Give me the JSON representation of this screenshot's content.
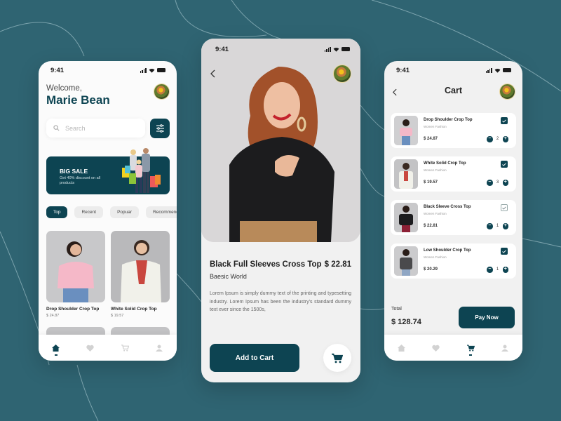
{
  "theme": {
    "primary": "#0d4452",
    "background": "#2f6472",
    "surface": "#f1f1f1"
  },
  "status_bar": {
    "time": "9:41",
    "icons": [
      "signal-icon",
      "wifi-icon",
      "battery-icon"
    ]
  },
  "home": {
    "welcome": "Welcome,",
    "username": "Marie Bean",
    "search": {
      "placeholder": "Search",
      "value": ""
    },
    "filter_icon": "sliders-icon",
    "banner": {
      "title": "BIG SALE",
      "subtitle": "Get 40% discount on all products"
    },
    "tabs": [
      {
        "label": "Top",
        "active": true
      },
      {
        "label": "Recent",
        "active": false
      },
      {
        "label": "Popuar",
        "active": false
      },
      {
        "label": "Recommended",
        "active": false
      }
    ],
    "products": [
      {
        "name": "Drop Shoulder Crop Top",
        "price": "$ 24.87"
      },
      {
        "name": "White Solid Crop Top",
        "price": "$ 19.57"
      }
    ],
    "nav": [
      {
        "icon": "home-icon",
        "active": true
      },
      {
        "icon": "heart-icon",
        "active": false
      },
      {
        "icon": "cart-icon",
        "active": false
      },
      {
        "icon": "user-icon",
        "active": false
      }
    ]
  },
  "detail": {
    "title": "Black Full Sleeves Cross Top",
    "price": "$ 22.81",
    "brand": "Baesic World",
    "description": "Lorem Ipsum is simply dummy text of the printing and typesetting industry. Lorem Ipsum has been the industry's standard dummy text ever since the 1500s,",
    "add_to_cart": "Add to Cart"
  },
  "cart": {
    "title": "Cart",
    "items": [
      {
        "name": "Drop Shoulder Crop Top",
        "category": "Women Fashion",
        "price": "$ 24.87",
        "qty": "2",
        "checked": true
      },
      {
        "name": "White Solid Crop Top",
        "category": "Women Fashion",
        "price": "$ 19.57",
        "qty": "3",
        "checked": true
      },
      {
        "name": "Black Sleeve Cross Top",
        "category": "Women Fashion",
        "price": "$ 22.81",
        "qty": "1",
        "checked": false
      },
      {
        "name": "Low Shoulder Crop Top",
        "category": "Women Fashion",
        "price": "$ 20.29",
        "qty": "1",
        "checked": true
      }
    ],
    "total_label": "Total",
    "total": "$ 128.74",
    "pay_now": "Pay Now",
    "nav": [
      {
        "icon": "home-icon",
        "active": false
      },
      {
        "icon": "heart-icon",
        "active": false
      },
      {
        "icon": "cart-icon",
        "active": true
      },
      {
        "icon": "user-icon",
        "active": false
      }
    ]
  }
}
